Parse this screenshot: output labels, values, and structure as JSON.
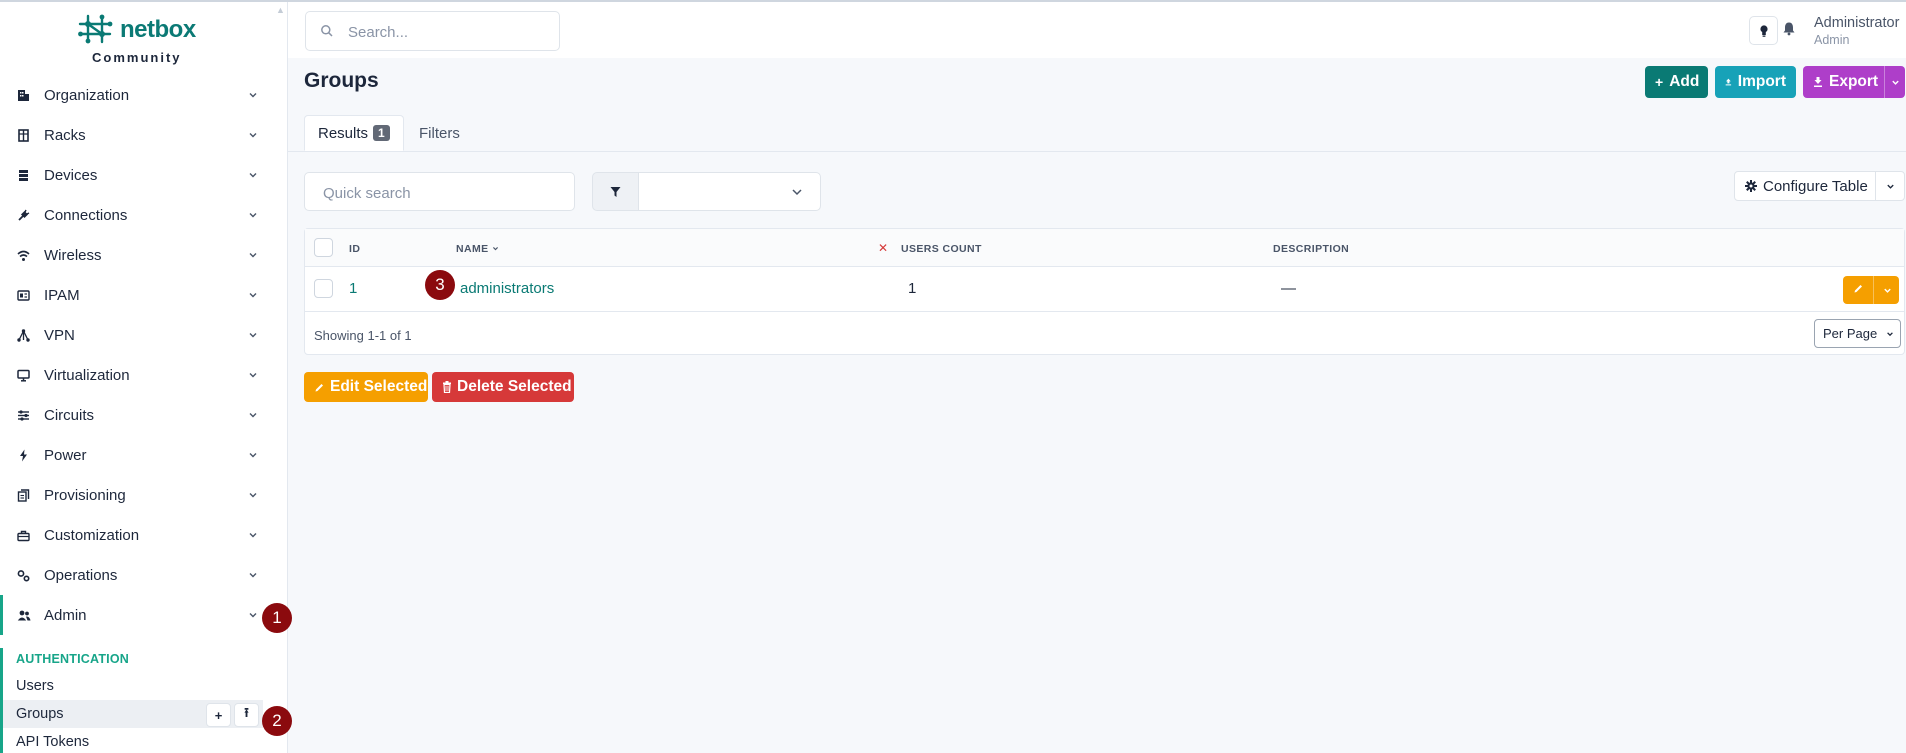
{
  "app": {
    "logo_text": "netbox",
    "logo_subtitle": "Community",
    "brand_color": "#0a7a74"
  },
  "sidebar": {
    "items": [
      {
        "label": "Organization",
        "icon": "building-icon"
      },
      {
        "label": "Racks",
        "icon": "rack-icon"
      },
      {
        "label": "Devices",
        "icon": "server-icon"
      },
      {
        "label": "Connections",
        "icon": "plug-icon"
      },
      {
        "label": "Wireless",
        "icon": "wifi-icon"
      },
      {
        "label": "IPAM",
        "icon": "ip-icon"
      },
      {
        "label": "VPN",
        "icon": "network-icon"
      },
      {
        "label": "Virtualization",
        "icon": "monitor-icon"
      },
      {
        "label": "Circuits",
        "icon": "circuit-icon"
      },
      {
        "label": "Power",
        "icon": "lightning-icon"
      },
      {
        "label": "Provisioning",
        "icon": "files-icon"
      },
      {
        "label": "Customization",
        "icon": "toolbox-icon"
      },
      {
        "label": "Operations",
        "icon": "cog-icon"
      },
      {
        "label": "Admin",
        "icon": "users-icon",
        "active": true
      }
    ],
    "submenu": {
      "heading": "AUTHENTICATION",
      "items": [
        {
          "label": "Users"
        },
        {
          "label": "Groups",
          "selected": true,
          "add_glyph": "+",
          "import_glyph": "⭱"
        },
        {
          "label": "API Tokens"
        }
      ]
    }
  },
  "markers": [
    "1",
    "2",
    "3"
  ],
  "header": {
    "search_placeholder": "Search...",
    "user_name": "Administrator",
    "user_role": "Admin"
  },
  "page": {
    "title": "Groups",
    "buttons": {
      "add": "Add",
      "import": "Import",
      "export": "Export"
    },
    "tabs": {
      "results": "Results",
      "results_count": "1",
      "filters": "Filters"
    }
  },
  "table_controls": {
    "quick_search_placeholder": "Quick search",
    "configure_table": "Configure Table"
  },
  "table": {
    "columns": [
      "ID",
      "NAME",
      "USERS COUNT",
      "DESCRIPTION"
    ],
    "rows": [
      {
        "id": "1",
        "name": "administrators",
        "users_count": "1",
        "description": "—"
      }
    ],
    "showing": "Showing 1-1 of 1",
    "per_page": "Per Page"
  },
  "bulk": {
    "edit": "Edit Selected",
    "delete": "Delete Selected"
  },
  "colors": {
    "accent": "#17a589",
    "warning": "#f59f00",
    "danger": "#d63939",
    "info": "#17a2b8",
    "purple": "#ae3ec9",
    "marker": "#8b0a0e"
  }
}
